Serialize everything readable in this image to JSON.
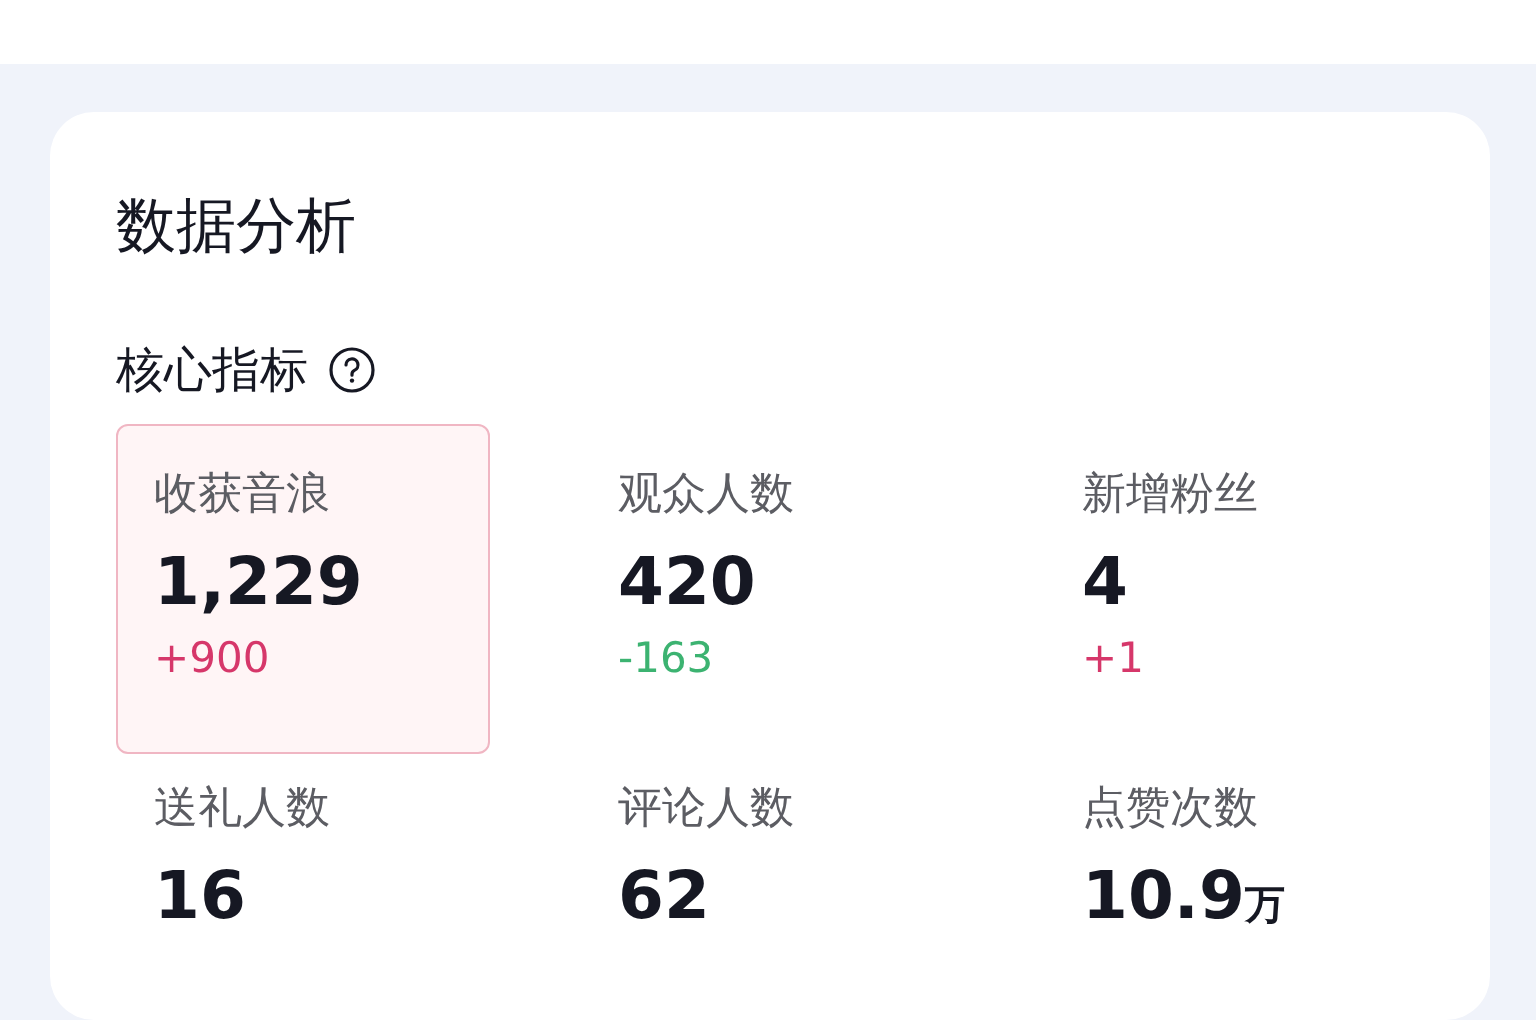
{
  "card": {
    "title": "数据分析",
    "section": {
      "title": "核心指标"
    },
    "metrics": [
      {
        "label": "收获音浪",
        "value": "1,229",
        "delta": "+900",
        "color": "#d6376a",
        "selected": true
      },
      {
        "label": "观众人数",
        "value": "420",
        "delta": "-163",
        "color": "#3cb371",
        "selected": false
      },
      {
        "label": "新增粉丝",
        "value": "4",
        "delta": "+1",
        "color": "#d6376a",
        "selected": false
      },
      {
        "label": "送礼人数",
        "value": "16",
        "selected": false
      },
      {
        "label": "评论人数",
        "value": "62",
        "selected": false
      },
      {
        "label": "点赞次数",
        "value": "10.9",
        "unit": "万",
        "selected": false
      }
    ]
  }
}
